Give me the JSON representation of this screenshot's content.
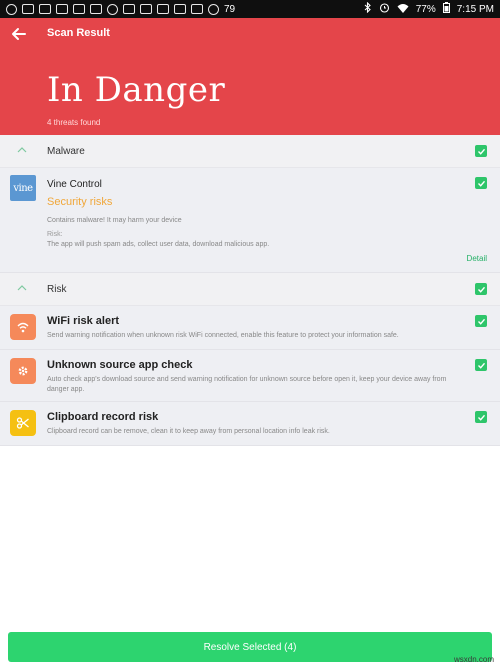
{
  "status_bar": {
    "icons": [
      "notification-icon",
      "gallery-icon",
      "mail-icon",
      "instagram-icon",
      "instagram-icon",
      "instagram-icon",
      "emoji-icon",
      "warning-icon",
      "gallery-icon",
      "text-icon",
      "photo-icon",
      "instagram-icon",
      "temperature-icon"
    ],
    "temperature": "79",
    "battery": "77%",
    "time": "7:15 PM",
    "right_icons": [
      "bluetooth-icon",
      "alarm-icon",
      "wifi-icon",
      "battery-icon"
    ]
  },
  "header": {
    "title": "Scan Result",
    "status": "In Danger",
    "subtitle": "4 threats found",
    "bg_color": "#e4454a"
  },
  "sections": {
    "malware": {
      "label": "Malware",
      "app": {
        "logo_text": "vine",
        "name": "Vine Control",
        "risk_title": "Security risks",
        "description": "Contains malware! It may harm your device",
        "risk_label": "Risk:",
        "risk_text": "The app will push spam ads, collect user data, download malicious app.",
        "detail_label": "Detail"
      }
    },
    "risk": {
      "label": "Risk",
      "items": [
        {
          "title": "WiFi risk alert",
          "description": "Send warning notification when unknown risk WiFi connected, enable this feature to protect your information safe.",
          "icon": "wifi-icon",
          "color": "#f5895a"
        },
        {
          "title": "Unknown source app check",
          "description": "Auto check app's download source and send warning notification for unknown source before open it, keep your device away from danger app.",
          "icon": "gear-icon",
          "color": "#f5895a"
        },
        {
          "title": "Clipboard record risk",
          "description": "Clipboard record can be remove, clean it to keep away from personal location info leak risk.",
          "icon": "scissors-icon",
          "color": "#f5c012"
        }
      ]
    }
  },
  "footer": {
    "resolve_label": "Resolve Selected (4)",
    "watermark": "wsxdn.com"
  },
  "colors": {
    "accent_green": "#2dd46f",
    "warning_orange": "#f0a73a"
  }
}
